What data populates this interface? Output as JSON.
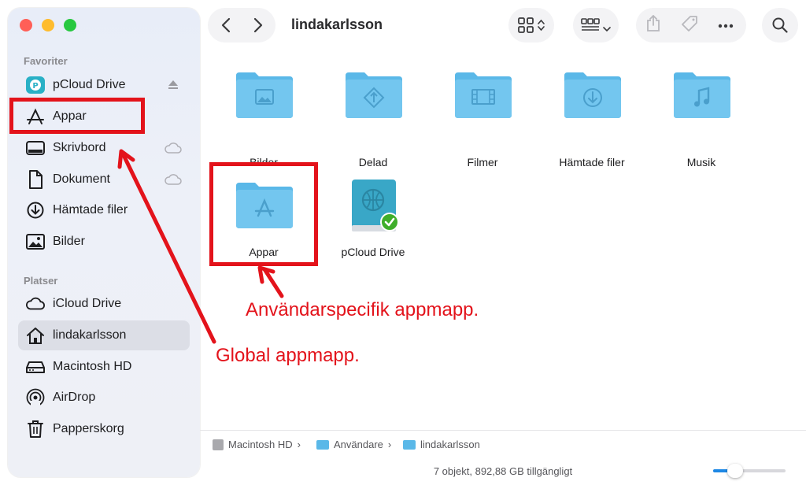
{
  "window": {
    "title": "lindakarlsson"
  },
  "sidebar": {
    "favorites_title": "Favoriter",
    "favorites": [
      {
        "label": "pCloud Drive",
        "icon": "pcloud-icon"
      },
      {
        "label": "Appar",
        "icon": "apps-icon"
      },
      {
        "label": "Skrivbord",
        "icon": "desktop-icon"
      },
      {
        "label": "Dokument",
        "icon": "document-icon"
      },
      {
        "label": "Hämtade filer",
        "icon": "download-icon"
      },
      {
        "label": "Bilder",
        "icon": "photo-icon"
      }
    ],
    "places_title": "Platser",
    "places": [
      {
        "label": "iCloud Drive",
        "icon": "cloud-icon"
      },
      {
        "label": "lindakarlsson",
        "icon": "home-icon",
        "selected": true
      },
      {
        "label": "Macintosh HD",
        "icon": "harddrive-icon"
      },
      {
        "label": "AirDrop",
        "icon": "airdrop-icon"
      },
      {
        "label": "Papperskorg",
        "icon": "trash-icon"
      }
    ]
  },
  "files": [
    {
      "name": "Bilder",
      "icon": "folder-pictures-icon"
    },
    {
      "name": "Delad",
      "icon": "folder-shared-icon"
    },
    {
      "name": "Filmer",
      "icon": "folder-movies-icon"
    },
    {
      "name": "Hämtade filer",
      "icon": "folder-downloads-icon"
    },
    {
      "name": "Musik",
      "icon": "folder-music-icon"
    },
    {
      "name": "Appar",
      "icon": "folder-apps-icon"
    },
    {
      "name": "pCloud Drive",
      "icon": "pcloud-drive-icon"
    }
  ],
  "pathbar": {
    "crumbs": [
      "Macintosh HD",
      "Användare",
      "lindakarlsson"
    ],
    "separator": "›"
  },
  "status": {
    "text": "7 objekt, 892,88 GB tillgängligt"
  },
  "annotations": {
    "user_apps": "Användarspecifik appmapp.",
    "global_apps": "Global appmapp."
  },
  "colors": {
    "accent": "#1e88e5",
    "folder": "#5ab8e8",
    "annotation": "#e3131b"
  }
}
